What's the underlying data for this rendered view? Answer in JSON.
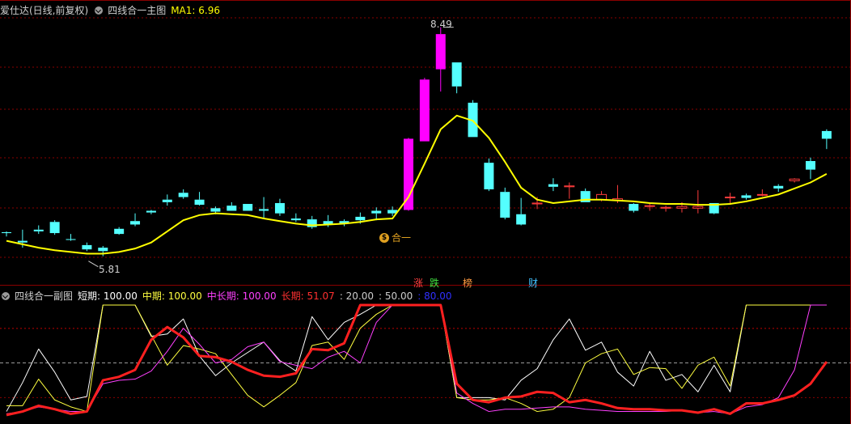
{
  "main_panel": {
    "stock_name": "爱仕达(日线,前复权)",
    "indicator_name": "四线合一主图",
    "ma_label": "MA1: 6.96",
    "high_label": "8.49",
    "low_label": "5.81",
    "signal_label": "合一",
    "event_tags": [
      {
        "text": "涨",
        "color": "#ff4040"
      },
      {
        "text": "跌",
        "color": "#40e040"
      },
      {
        "text": "榜",
        "color": "#ff9a40"
      },
      {
        "text": "财",
        "color": "#40c0ff"
      }
    ]
  },
  "sub_panel": {
    "indicator_name": "四线合一副图",
    "items": [
      {
        "text": "短期: 100.00",
        "color": "#ffffff"
      },
      {
        "text": "中期: 100.00",
        "color": "#ffff40"
      },
      {
        "text": "中长期: 100.00",
        "color": "#ff40ff"
      },
      {
        "text": "长期: 51.07",
        "color": "#ff3030"
      },
      {
        "text": ": 20.00",
        "color": "#cccccc"
      },
      {
        "text": ": 50.00",
        "color": "#cccccc"
      },
      {
        "text": ": 80.00",
        "color": "#3030ff"
      }
    ]
  },
  "colors": {
    "up": "#ff3c3c",
    "down": "#54ffff",
    "limit_up": "#ff00ff",
    "ma": "#ffff00",
    "grid": "#8a0000"
  },
  "chart_data": [
    {
      "type": "candlestick",
      "ylim": [
        5.6,
        8.6
      ],
      "series": [
        {
          "name": "K",
          "ohlc": [
            [
              6.1,
              6.11,
              6.09,
              6.05
            ],
            [
              6.0,
              6.13,
              5.98,
              5.92
            ],
            [
              6.13,
              6.18,
              6.11,
              6.08
            ],
            [
              6.22,
              6.24,
              6.09,
              6.07
            ],
            [
              6.02,
              6.08,
              6.01,
              6.0
            ],
            [
              5.95,
              5.98,
              5.9,
              5.88
            ],
            [
              5.92,
              5.94,
              5.88,
              5.82
            ],
            [
              6.14,
              6.16,
              6.08,
              6.07
            ],
            [
              6.23,
              6.32,
              6.19,
              6.17
            ],
            [
              6.35,
              6.36,
              6.33,
              6.31
            ],
            [
              6.48,
              6.54,
              6.45,
              6.41
            ],
            [
              6.56,
              6.6,
              6.51,
              6.49
            ],
            [
              6.48,
              6.57,
              6.42,
              6.41
            ],
            [
              6.38,
              6.4,
              6.34,
              6.31
            ],
            [
              6.41,
              6.45,
              6.35,
              6.35
            ],
            [
              6.43,
              6.43,
              6.35,
              6.35
            ],
            [
              6.37,
              6.51,
              6.35,
              6.26
            ],
            [
              6.44,
              6.49,
              6.32,
              6.29
            ],
            [
              6.26,
              6.32,
              6.24,
              6.22
            ],
            [
              6.25,
              6.29,
              6.16,
              6.14
            ],
            [
              6.23,
              6.3,
              6.19,
              6.16
            ],
            [
              6.23,
              6.25,
              6.2,
              6.17
            ],
            [
              6.28,
              6.33,
              6.24,
              6.2
            ],
            [
              6.35,
              6.39,
              6.32,
              6.24
            ],
            [
              6.36,
              6.4,
              6.32,
              6.29
            ],
            [
              7.19,
              7.2,
              6.36,
              6.35
            ],
            [
              7.88,
              7.9,
              7.16,
              7.16
            ],
            [
              8.41,
              8.49,
              8.0,
              7.74
            ],
            [
              8.08,
              8.08,
              7.8,
              7.72
            ],
            [
              7.61,
              7.64,
              7.21,
              7.21
            ],
            [
              6.91,
              6.96,
              6.6,
              6.58
            ],
            [
              6.57,
              6.62,
              6.27,
              6.25
            ],
            [
              6.31,
              6.5,
              6.19,
              6.18
            ],
            [
              6.43,
              6.51,
              6.44,
              6.37
            ],
            [
              6.66,
              6.73,
              6.63,
              6.58
            ],
            [
              6.63,
              6.68,
              6.64,
              6.49
            ],
            [
              6.58,
              6.61,
              6.45,
              6.45
            ],
            [
              6.48,
              6.58,
              6.54,
              6.46
            ],
            [
              6.47,
              6.65,
              6.49,
              6.44
            ],
            [
              6.43,
              6.44,
              6.35,
              6.33
            ],
            [
              6.4,
              6.43,
              6.41,
              6.35
            ],
            [
              6.38,
              6.41,
              6.39,
              6.34
            ],
            [
              6.38,
              6.45,
              6.4,
              6.33
            ],
            [
              6.38,
              6.59,
              6.4,
              6.32
            ],
            [
              6.44,
              6.44,
              6.32,
              6.31
            ],
            [
              6.51,
              6.56,
              6.51,
              6.42
            ],
            [
              6.53,
              6.55,
              6.5,
              6.48
            ],
            [
              6.54,
              6.6,
              6.54,
              6.52
            ],
            [
              6.64,
              6.66,
              6.61,
              6.57
            ],
            [
              6.7,
              6.73,
              6.72,
              6.68
            ],
            [
              6.93,
              6.97,
              6.83,
              6.72
            ],
            [
              7.28,
              7.3,
              7.19,
              7.07
            ]
          ]
        },
        {
          "name": "MA1",
          "values": [
            6.0,
            5.96,
            5.92,
            5.89,
            5.87,
            5.85,
            5.85,
            5.87,
            5.91,
            5.98,
            6.11,
            6.24,
            6.3,
            6.32,
            6.31,
            6.3,
            6.26,
            6.23,
            6.2,
            6.18,
            6.19,
            6.2,
            6.22,
            6.25,
            6.26,
            6.51,
            6.9,
            7.3,
            7.46,
            7.4,
            7.2,
            6.92,
            6.62,
            6.48,
            6.44,
            6.46,
            6.48,
            6.48,
            6.47,
            6.46,
            6.44,
            6.43,
            6.43,
            6.42,
            6.42,
            6.43,
            6.46,
            6.5,
            6.54,
            6.61,
            6.68,
            6.78
          ]
        }
      ]
    },
    {
      "type": "line",
      "ylim": [
        0,
        100
      ],
      "series": [
        {
          "name": "短期",
          "color": "#ffffff",
          "values": [
            8,
            33,
            62,
            42,
            18,
            21,
            100,
            100,
            100,
            73,
            75,
            88,
            56,
            39,
            50,
            59,
            68,
            52,
            43,
            90,
            70,
            85,
            92,
            100,
            100,
            100,
            100,
            100,
            20,
            20,
            20,
            18,
            35,
            45,
            70,
            88,
            61,
            68,
            42,
            30,
            60,
            35,
            40,
            25,
            48,
            25,
            100,
            100,
            100,
            100,
            100,
            100
          ]
        },
        {
          "name": "中期",
          "color": "#ffff40",
          "values": [
            13,
            13,
            36,
            18,
            12,
            8,
            100,
            100,
            100,
            74,
            48,
            65,
            62,
            58,
            40,
            22,
            12,
            22,
            33,
            65,
            68,
            53,
            80,
            92,
            100,
            100,
            100,
            100,
            20,
            18,
            18,
            20,
            15,
            8,
            10,
            20,
            50,
            58,
            62,
            40,
            46,
            45,
            28,
            48,
            55,
            30,
            100,
            100,
            100,
            100,
            100,
            100
          ]
        },
        {
          "name": "中长期",
          "color": "#ff40ff",
          "values": [
            6,
            8,
            12,
            10,
            8,
            8,
            32,
            35,
            36,
            43,
            60,
            80,
            66,
            50,
            53,
            64,
            68,
            51,
            48,
            45,
            55,
            60,
            50,
            85,
            100,
            100,
            100,
            100,
            24,
            15,
            8,
            10,
            10,
            11,
            12,
            12,
            10,
            9,
            8,
            8,
            8,
            8,
            9,
            7,
            8,
            6,
            12,
            14,
            20,
            44,
            100,
            100
          ]
        },
        {
          "name": "长期",
          "color": "#ff2020",
          "values": [
            5,
            8,
            13,
            10,
            6,
            8,
            35,
            38,
            44,
            70,
            81,
            72,
            56,
            55,
            51,
            44,
            39,
            38,
            41,
            62,
            61,
            67,
            100,
            100,
            100,
            100,
            100,
            100,
            32,
            18,
            16,
            20,
            21,
            25,
            24,
            16,
            18,
            15,
            11,
            10,
            10,
            9,
            9,
            7,
            10,
            6,
            15,
            15,
            18,
            22,
            32,
            51
          ]
        },
        {
          "name": "20",
          "color": "#aaaaaa",
          "values": [
            20
          ]
        },
        {
          "name": "50",
          "color": "#cccccc",
          "values": [
            50
          ]
        },
        {
          "name": "80",
          "color": "#3030ff",
          "values": [
            80
          ]
        }
      ]
    }
  ]
}
